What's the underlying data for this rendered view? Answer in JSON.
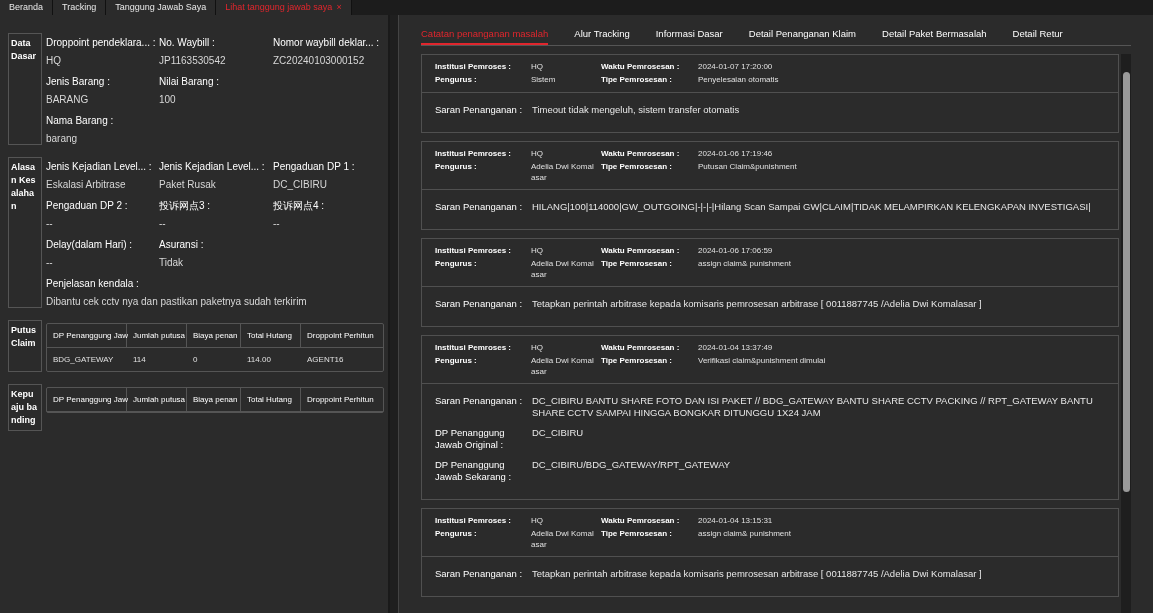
{
  "top_tabs": [
    {
      "label": "Beranda",
      "selected": false
    },
    {
      "label": "Tracking",
      "selected": false
    },
    {
      "label": "Tanggung Jawab Saya",
      "selected": false
    },
    {
      "label": "Lihat tanggung jawab saya",
      "selected": true,
      "close": "×"
    }
  ],
  "sections": [
    {
      "kind": "fields",
      "label": "Data Dasar",
      "fields": [
        {
          "label": "Droppoint pendeklara... :",
          "value": "HQ"
        },
        {
          "label": "No. Waybill :",
          "value": "JP1163530542"
        },
        {
          "label": "Nomor waybill deklar... :",
          "value": "ZC20240103000152"
        },
        {
          "label": "Jenis Barang :",
          "value": "BARANG"
        },
        {
          "label": "Nilai Barang :",
          "value": "100"
        }
      ],
      "note": {
        "label": "Nama Barang :",
        "value": "barang"
      }
    },
    {
      "kind": "fields",
      "label": "Alasan Kesalahan",
      "fields": [
        {
          "label": "Jenis Kejadian Level... :",
          "value": "Eskalasi Arbitrase"
        },
        {
          "label": "Jenis Kejadian Level... :",
          "value": "Paket Rusak"
        },
        {
          "label": "Pengaduan DP 1 :",
          "value": "DC_CIBIRU"
        },
        {
          "label": "Pengaduan DP 2 :",
          "value": "--"
        },
        {
          "label": "投诉网点3 :",
          "value": "--"
        },
        {
          "label": "投诉网点4 :",
          "value": "--"
        },
        {
          "label": "Delay(dalam Hari) :",
          "value": "--"
        },
        {
          "label": "Asuransi :",
          "value": "Tidak"
        }
      ],
      "note": {
        "label": "Penjelasan kendala :",
        "value": "Dibantu cek cctv nya dan pastikan paketnya sudah terkirim"
      }
    },
    {
      "kind": "table",
      "label": "Putus Claim",
      "columns": [
        "DP Penanggung Jaw",
        "Jumlah putusa",
        "Biaya penan",
        "Total Hutang",
        "Droppoint Perhitun"
      ],
      "rows": [
        [
          "BDG_GATEWAY",
          "114",
          "0",
          "114.00",
          "AGENT16"
        ]
      ]
    },
    {
      "kind": "table",
      "label": "Kepu aju banding",
      "columns": [
        "DP Penanggung Jaw",
        "Jumlah putusa",
        "Biaya penan",
        "Total Hutang",
        "Droppoint Perhitun"
      ]
    }
  ],
  "detail_tabs": [
    {
      "label": "Catatan penanganan masalah",
      "selected": true
    },
    {
      "label": "Alur Tracking",
      "selected": false
    },
    {
      "label": "Informasi Dasar",
      "selected": false
    },
    {
      "label": "Detail Penanganan Klaim",
      "selected": false
    },
    {
      "label": "Detail Paket Bermasalah",
      "selected": false
    },
    {
      "label": "Detail Retur",
      "selected": false
    }
  ],
  "records": [
    {
      "meta": [
        {
          "label": "Institusi Pemroses :",
          "value": "HQ"
        },
        {
          "label": "Waktu Pemrosesan :",
          "value": "2024-01-07 17:20:00"
        },
        {
          "label": "Pengurus :",
          "value": "Sistem"
        },
        {
          "label": "Tipe Pemrosesan :",
          "value": "Penyelesaian otomatis"
        }
      ],
      "details": [
        {
          "label": "Saran Penanganan :",
          "value": "Timeout tidak mengeluh, sistem transfer otomatis"
        }
      ]
    },
    {
      "meta": [
        {
          "label": "Institusi Pemroses :",
          "value": "HQ"
        },
        {
          "label": "Waktu Pemrosesan :",
          "value": "2024-01-06 17:19:46"
        },
        {
          "label": "Pengurus :",
          "value": "Adelia Dwi Komal asar"
        },
        {
          "label": "Tipe Pemrosesan :",
          "value": "Putusan Claim&punishment"
        }
      ],
      "details": [
        {
          "label": "Saran Penanganan :",
          "value": "HILANG|100|114000|GW_OUTGOING|-|-|-|Hilang Scan Sampai GW|CLAIM|TIDAK MELAMPIRKAN KELENGKAPAN INVESTIGASI|"
        }
      ]
    },
    {
      "meta": [
        {
          "label": "Institusi Pemroses :",
          "value": "HQ"
        },
        {
          "label": "Waktu Pemrosesan :",
          "value": "2024-01-06 17:06:59"
        },
        {
          "label": "Pengurus :",
          "value": "Adelia Dwi Komal asar"
        },
        {
          "label": "Tipe Pemrosesan :",
          "value": "assign claim& punishment"
        }
      ],
      "details": [
        {
          "label": "Saran Penanganan :",
          "value": "Tetapkan perintah arbitrase kepada komisaris pemrosesan arbitrase [ 0011887745 /Adelia Dwi Komalasar ]"
        }
      ]
    },
    {
      "meta": [
        {
          "label": "Institusi Pemroses :",
          "value": "HQ"
        },
        {
          "label": "Waktu Pemrosesan :",
          "value": "2024-01-04 13:37:49"
        },
        {
          "label": "Pengurus :",
          "value": "Adelia Dwi Komal asar"
        },
        {
          "label": "Tipe Pemrosesan :",
          "value": "Verifikasi claim&punishment dimulai"
        }
      ],
      "details": [
        {
          "label": "Saran Penanganan :",
          "value": "DC_CIBIRU BANTU SHARE FOTO DAN ISI PAKET // BDG_GATEWAY BANTU SHARE CCTV PACKING // RPT_GATEWAY BANTU SHARE CCTV SAMPAI HINGGA BONGKAR DITUNGGU 1X24 JAM"
        },
        {
          "label": "DP Penanggung Jawab Original :",
          "value": "DC_CIBIRU"
        },
        {
          "label": "DP Penanggung Jawab Sekarang :",
          "value": "DC_CIBIRU/BDG_GATEWAY/RPT_GATEWAY"
        }
      ]
    },
    {
      "meta": [
        {
          "label": "Institusi Pemroses :",
          "value": "HQ"
        },
        {
          "label": "Waktu Pemrosesan :",
          "value": "2024-01-04 13:15:31"
        },
        {
          "label": "Pengurus :",
          "value": "Adelia Dwi Komal asar"
        },
        {
          "label": "Tipe Pemrosesan :",
          "value": "assign claim& punishment"
        }
      ],
      "details": [
        {
          "label": "Saran Penanganan :",
          "value": "Tetapkan perintah arbitrase kepada komisaris pemrosesan arbitrase [ 0011887745 /Adelia Dwi Komalasar ]"
        }
      ]
    }
  ]
}
